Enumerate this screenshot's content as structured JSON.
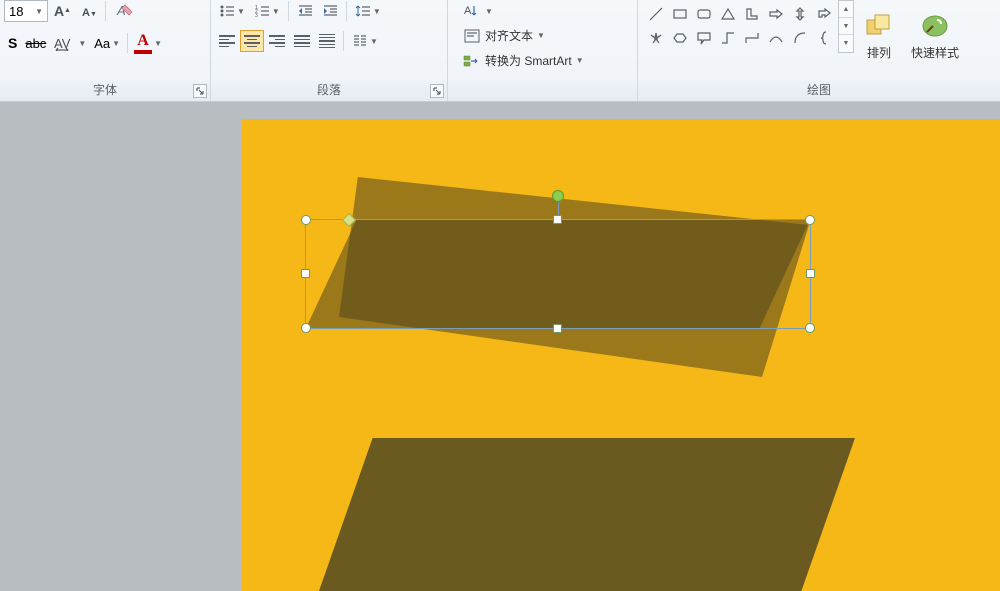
{
  "font": {
    "size": "18",
    "group_label": "字体",
    "color_fallback": "A"
  },
  "paragraph": {
    "group_label": "段落"
  },
  "align": {
    "direction_label": "",
    "align_text_label": "对齐文本",
    "smartart_label": "转换为 SmartArt"
  },
  "drawing": {
    "group_label": "绘图",
    "arrange_label": "排列",
    "quick_style_label": "快速样式"
  }
}
